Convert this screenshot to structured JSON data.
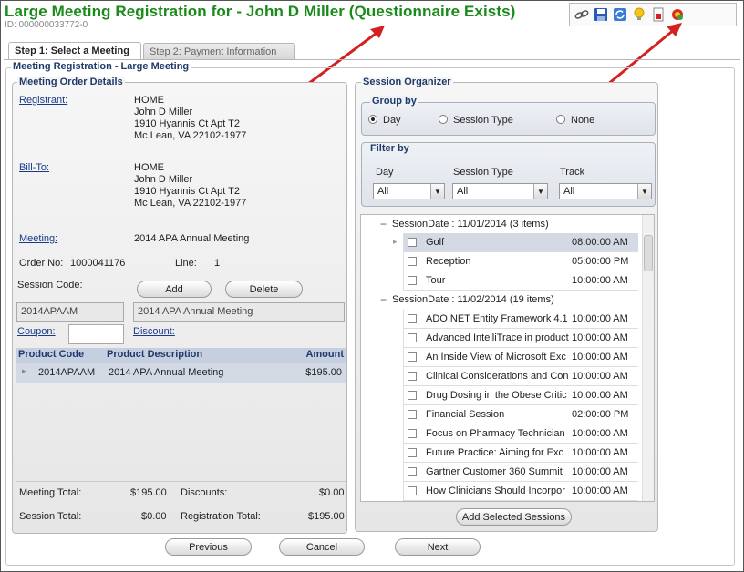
{
  "header": {
    "title": "Large Meeting Registration for - John D Miller (Questionnaire Exists)",
    "id_text": "ID: 000000033772-0"
  },
  "toolbar": {
    "icons": [
      "link-icon",
      "save-icon",
      "refresh-icon",
      "lightbulb-icon",
      "report-icon",
      "settings-icon"
    ]
  },
  "tabs": [
    {
      "label": "Step 1: Select a Meeting"
    },
    {
      "label": "Step 2: Payment Information"
    }
  ],
  "section_title": "Meeting Registration - Large Meeting",
  "order": {
    "title": "Meeting Order Details",
    "registrant_label": "Registrant:",
    "registrant_addr": {
      "l1": "HOME",
      "l2": "John D Miller",
      "l3": "1910 Hyannis Ct Apt T2",
      "l4": "Mc Lean, VA  22102-1977"
    },
    "billto_label": "Bill-To:",
    "billto_addr": {
      "l1": "HOME",
      "l2": "John D Miller",
      "l3": "1910 Hyannis Ct Apt T2",
      "l4": "Mc Lean, VA  22102-1977"
    },
    "meeting_label": "Meeting:",
    "meeting_value": "2014 APA Annual Meeting",
    "order_no_label": "Order No:",
    "order_no_value": "1000041176",
    "line_label": "Line:",
    "line_value": "1",
    "session_code_label": "Session Code:",
    "add_label": "Add",
    "delete_label": "Delete",
    "code_value": "2014APAAM",
    "code_desc": "2014 APA Annual Meeting",
    "coupon_label": "Coupon:",
    "discount_label": "Discount:",
    "grid": {
      "headers": {
        "code": "Product Code",
        "desc": "Product Description",
        "amount": "Amount"
      },
      "rows": [
        {
          "code": "2014APAAM",
          "desc": "2014 APA Annual Meeting",
          "amount": "$195.00"
        }
      ]
    },
    "totals": {
      "meeting_total_label": "Meeting Total:",
      "meeting_total": "$195.00",
      "discounts_label": "Discounts:",
      "discounts": "$0.00",
      "session_total_label": "Session Total:",
      "session_total": "$0.00",
      "registration_total_label": "Registration Total:",
      "registration_total": "$195.00"
    }
  },
  "organizer": {
    "title": "Session Organizer",
    "group_by": {
      "title": "Group by",
      "options": [
        "Day",
        "Session Type",
        "None"
      ],
      "selected": "Day"
    },
    "filter_by": {
      "title": "Filter by",
      "day_label": "Day",
      "day_value": "All",
      "type_label": "Session Type",
      "type_value": "All",
      "track_label": "Track",
      "track_value": "All"
    },
    "group1_header": "SessionDate : 11/01/2014 (3 items)",
    "group1": [
      {
        "name": "Golf",
        "time": "08:00:00 AM"
      },
      {
        "name": "Reception",
        "time": "05:00:00 PM"
      },
      {
        "name": "Tour",
        "time": "10:00:00 AM"
      }
    ],
    "group2_header": "SessionDate : 11/02/2014 (19 items)",
    "group2": [
      {
        "name": "ADO.NET Entity Framework 4.1",
        "time": "10:00:00 AM"
      },
      {
        "name": "Advanced IntelliTrace in product",
        "time": "10:00:00 AM"
      },
      {
        "name": "An Inside View of Microsoft Exc",
        "time": "10:00:00 AM"
      },
      {
        "name": "Clinical Considerations and Con",
        "time": "10:00:00 AM"
      },
      {
        "name": "Drug Dosing in the Obese Critic",
        "time": "10:00:00 AM"
      },
      {
        "name": "Financial Session",
        "time": "02:00:00 PM"
      },
      {
        "name": "Focus on Pharmacy Technician",
        "time": "10:00:00 AM"
      },
      {
        "name": "Future Practice: Aiming for Exc",
        "time": "10:00:00 AM"
      },
      {
        "name": "Gartner Customer 360 Summit",
        "time": "10:00:00 AM"
      },
      {
        "name": "How Clinicians Should Incorpor",
        "time": "10:00:00 AM"
      }
    ],
    "add_sessions_label": "Add Selected Sessions"
  },
  "footer": {
    "previous": "Previous",
    "cancel": "Cancel",
    "next": "Next"
  },
  "colors": {
    "title_green": "#1a8a1a",
    "header_blue": "#1f3a6a",
    "arrow_red": "#d42020"
  }
}
